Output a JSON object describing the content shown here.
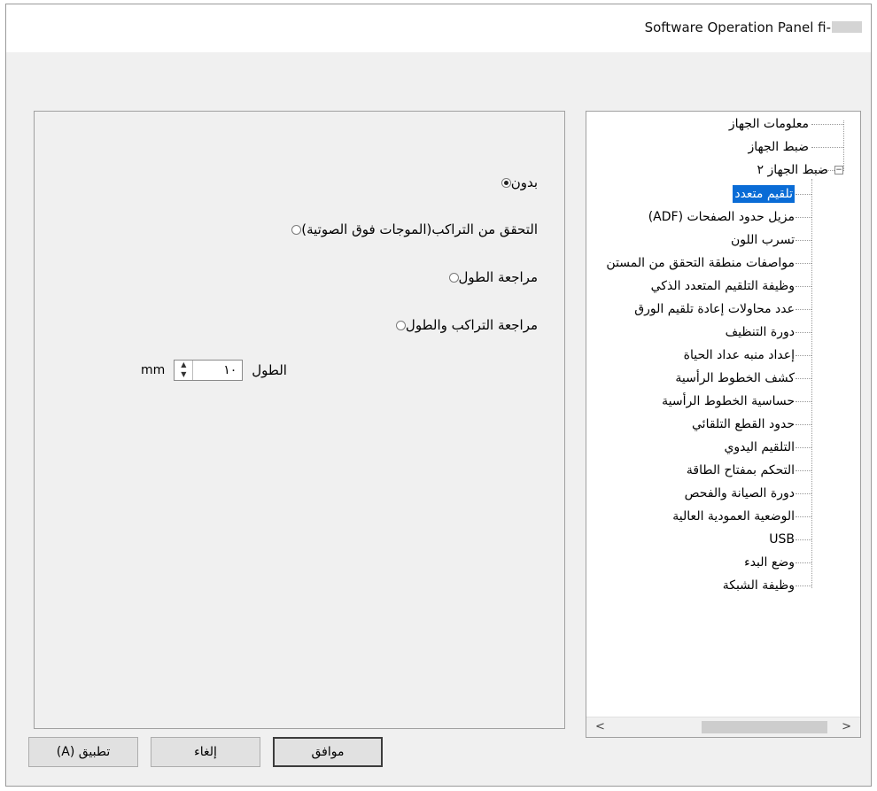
{
  "window": {
    "title": "Software Operation Panel fi-"
  },
  "settings": {
    "options": [
      {
        "label": "بدون",
        "checked": true
      },
      {
        "label": "التحقق من التراكب(الموجات فوق الصوتية)",
        "checked": false
      },
      {
        "label": "مراجعة الطول",
        "checked": false
      },
      {
        "label": "مراجعة  التراكب والطول",
        "checked": false
      }
    ],
    "length": {
      "label": "الطول",
      "value": "١٠",
      "unit": "mm",
      "spin_up": "▲",
      "spin_down": "▼"
    }
  },
  "tree": {
    "top_items": [
      {
        "label": "معلومات الجهاز"
      },
      {
        "label": "ضبط الجهاز"
      },
      {
        "label": "ضبط الجهاز ٢",
        "expander": "−"
      }
    ],
    "children": [
      {
        "label": "تلقيم متعدد",
        "selected": true
      },
      {
        "label": "مزيل حدود الصفحات (ADF)"
      },
      {
        "label": "تسرب اللون"
      },
      {
        "label": "مواصفات منطقة التحقق من المستن"
      },
      {
        "label": "وظيفة التلقيم المتعدد الذكي"
      },
      {
        "label": "عدد محاولات إعادة تلقيم الورق"
      },
      {
        "label": "دورة التنظيف"
      },
      {
        "label": "إعداد منبه عداد الحياة"
      },
      {
        "label": "كشف الخطوط الرأسية"
      },
      {
        "label": "حساسية الخطوط الرأسية"
      },
      {
        "label": "حدود القطع التلقائي"
      },
      {
        "label": "التلقيم اليدوي"
      },
      {
        "label": "التحكم بمفتاح الطاقة"
      },
      {
        "label": "دورة الصيانة والفحص"
      },
      {
        "label": "الوضعية العمودية العالية"
      },
      {
        "label": "USB"
      },
      {
        "label": "وضع البدء"
      },
      {
        "label": "وظيفة الشبكة"
      }
    ],
    "scroll_left": "<",
    "scroll_right": ">"
  },
  "buttons": {
    "ok": "موافق",
    "cancel": "إلغاء",
    "apply": "تطبيق (A)"
  }
}
